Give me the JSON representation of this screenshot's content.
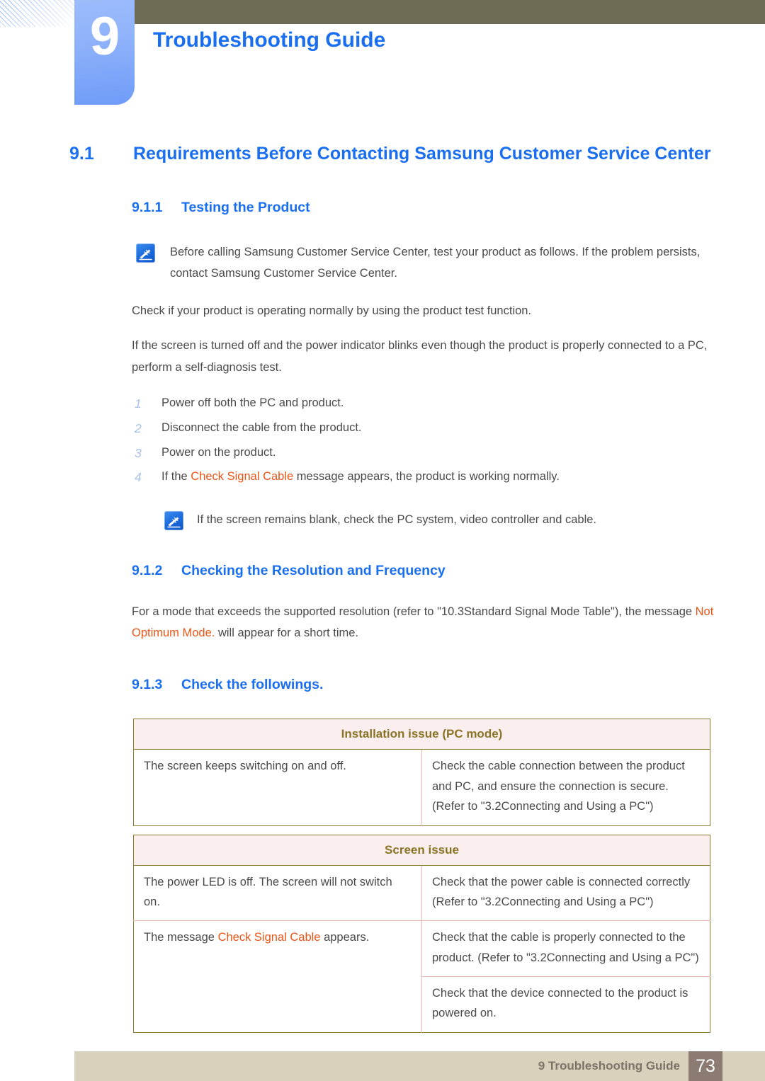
{
  "header": {
    "chapter_number": "9",
    "chapter_title": "Troubleshooting Guide",
    "tab_color": "#8fb2fa",
    "bar_color": "#6e6b55",
    "title_color": "#1a6ef0"
  },
  "section": {
    "number": "9.1",
    "title": "Requirements Before Contacting Samsung Customer Service Center"
  },
  "sub1": {
    "number": "9.1.1",
    "title": "Testing the Product",
    "note": "Before calling Samsung Customer Service Center, test your product as follows. If the problem persists, contact Samsung Customer Service Center.",
    "para1": "Check if your product is operating normally by using the product test function.",
    "para2": "If the screen is turned off and the power indicator blinks even though the product is properly connected to a PC, perform a self-diagnosis test.",
    "steps": [
      {
        "num": "1",
        "text": "Power off both the PC and product."
      },
      {
        "num": "2",
        "text": "Disconnect the cable from the product."
      },
      {
        "num": "3",
        "text": "Power on the product."
      },
      {
        "num": "4",
        "pre": "If the ",
        "highlight": "Check Signal Cable",
        "post": " message appears, the product is working normally."
      }
    ],
    "note2": "If the screen remains blank, check the PC system, video controller and cable."
  },
  "sub2": {
    "number": "9.1.2",
    "title": "Checking the Resolution and Frequency",
    "para_pre": "For a mode that exceeds the supported resolution (refer to \"10.3Standard Signal Mode Table\"), the message ",
    "para_highlight": "Not Optimum Mode.",
    "para_post": " will appear for a short time."
  },
  "sub3": {
    "number": "9.1.3",
    "title": "Check the followings."
  },
  "tables": [
    {
      "header": "Installation issue (PC mode)",
      "rows": [
        {
          "problem": "The screen keeps switching on and off.",
          "solutions": [
            "Check the cable connection between the product and PC, and ensure the connection is secure. (Refer to \"3.2Connecting and Using a PC\")"
          ]
        }
      ]
    },
    {
      "header": "Screen issue",
      "rows": [
        {
          "problem": "The power LED is off. The screen will not switch on.",
          "solutions": [
            "Check that the power cable is connected correctly (Refer to \"3.2Connecting and Using a PC\")"
          ]
        },
        {
          "problem_pre": "The message ",
          "problem_highlight": "Check Signal Cable",
          "problem_post": " appears.",
          "solutions": [
            "Check that the cable is properly connected to the product. (Refer to \"3.2Connecting and Using a PC\")",
            "Check that the device connected to the product is powered on."
          ]
        }
      ]
    }
  ],
  "footer": {
    "label": "9 Troubleshooting Guide",
    "page_number": "73",
    "bar_color": "#d8d2bd",
    "box_color": "#8c7b72"
  },
  "colors": {
    "heading_blue": "#1a6ef0",
    "highlight_orange": "#ea5518",
    "table_border": "#8a7d33",
    "table_header_bg": "#fbeeee",
    "table_header_text": "#8a7427",
    "step_number": "#a9c2e8"
  }
}
